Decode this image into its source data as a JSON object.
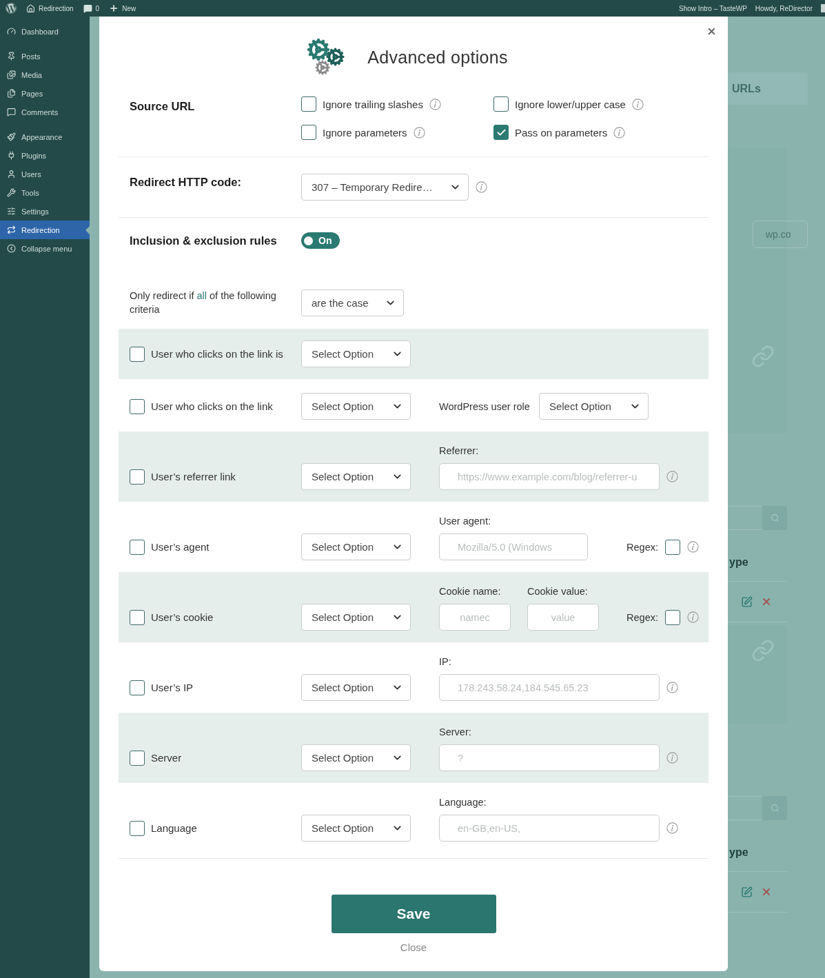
{
  "admin_bar": {
    "site": "Redirection",
    "comments": "0",
    "new": "New",
    "show_intro": "Show Intro – TasteWP",
    "howdy": "Howdy, ReDirector"
  },
  "sidebar": {
    "groups": [
      [
        {
          "label": "Dashboard",
          "selected": false
        }
      ],
      [
        {
          "label": "Posts",
          "selected": false
        },
        {
          "label": "Media",
          "selected": false
        },
        {
          "label": "Pages",
          "selected": false
        },
        {
          "label": "Comments",
          "selected": false
        }
      ],
      [
        {
          "label": "Appearance",
          "selected": false
        },
        {
          "label": "Plugins",
          "selected": false
        },
        {
          "label": "Users",
          "selected": false
        },
        {
          "label": "Tools",
          "selected": false
        },
        {
          "label": "Settings",
          "selected": false
        },
        {
          "label": "Redirection",
          "selected": true
        },
        {
          "label": "Collapse menu",
          "selected": false
        }
      ]
    ]
  },
  "background": {
    "heading": "URLs",
    "url_field": "wp.co",
    "column_headers": [
      "ype",
      "ype"
    ]
  },
  "modal": {
    "title": "Advanced options",
    "source_url": {
      "label": "Source URL",
      "options": [
        {
          "label": "Ignore trailing slashes",
          "checked": false
        },
        {
          "label": "Ignore lower/upper case",
          "checked": false
        },
        {
          "label": "Ignore parameters",
          "checked": false
        },
        {
          "label": "Pass on parameters",
          "checked": true
        }
      ]
    },
    "http_code": {
      "label": "Redirect HTTP code:",
      "value": "307 – Temporary Redire…"
    },
    "rules": {
      "label": "Inclusion & exclusion rules",
      "toggle_label": "On",
      "on": true,
      "condition": {
        "before": "Only redirect if ",
        "highlight": "all",
        "after": " of the following criteria",
        "value": "are the case"
      },
      "criteria": [
        {
          "kind": "plain",
          "label": "User who clicks on the link is",
          "checked": false,
          "select": "Select Option"
        },
        {
          "kind": "role",
          "label": "User who clicks on the link",
          "checked": false,
          "select": "Select Option",
          "role_label": "WordPress user role",
          "role_select": "Select Option"
        },
        {
          "kind": "field",
          "label": "User’s referrer link",
          "checked": false,
          "select": "Select Option",
          "field_label": "Referrer:",
          "placeholder": "https://www.example.com/blog/referrer-u"
        },
        {
          "kind": "regex",
          "label": "User’s agent",
          "checked": false,
          "select": "Select Option",
          "field_label": "User agent:",
          "placeholder": "Mozilla/5.0 (Windows",
          "regex_label": "Regex:",
          "regex_checked": false
        },
        {
          "kind": "cookie",
          "label": "User’s cookie",
          "checked": false,
          "select": "Select Option",
          "fields": [
            {
              "label": "Cookie name:",
              "placeholder": "namec"
            },
            {
              "label": "Cookie value:",
              "placeholder": "value"
            }
          ],
          "regex_label": "Regex:",
          "regex_checked": false
        },
        {
          "kind": "field",
          "label": "User’s IP",
          "checked": false,
          "select": "Select Option",
          "field_label": "IP:",
          "placeholder": "178.243.58.24,184.545.65.23"
        },
        {
          "kind": "field",
          "label": "Server",
          "checked": false,
          "select": "Select Option",
          "field_label": "Server:",
          "placeholder": "?"
        },
        {
          "kind": "field",
          "label": "Language",
          "checked": false,
          "select": "Select Option",
          "field_label": "Language:",
          "placeholder": "en-GB,en-US,"
        }
      ]
    },
    "save": "Save",
    "close": "Close"
  }
}
